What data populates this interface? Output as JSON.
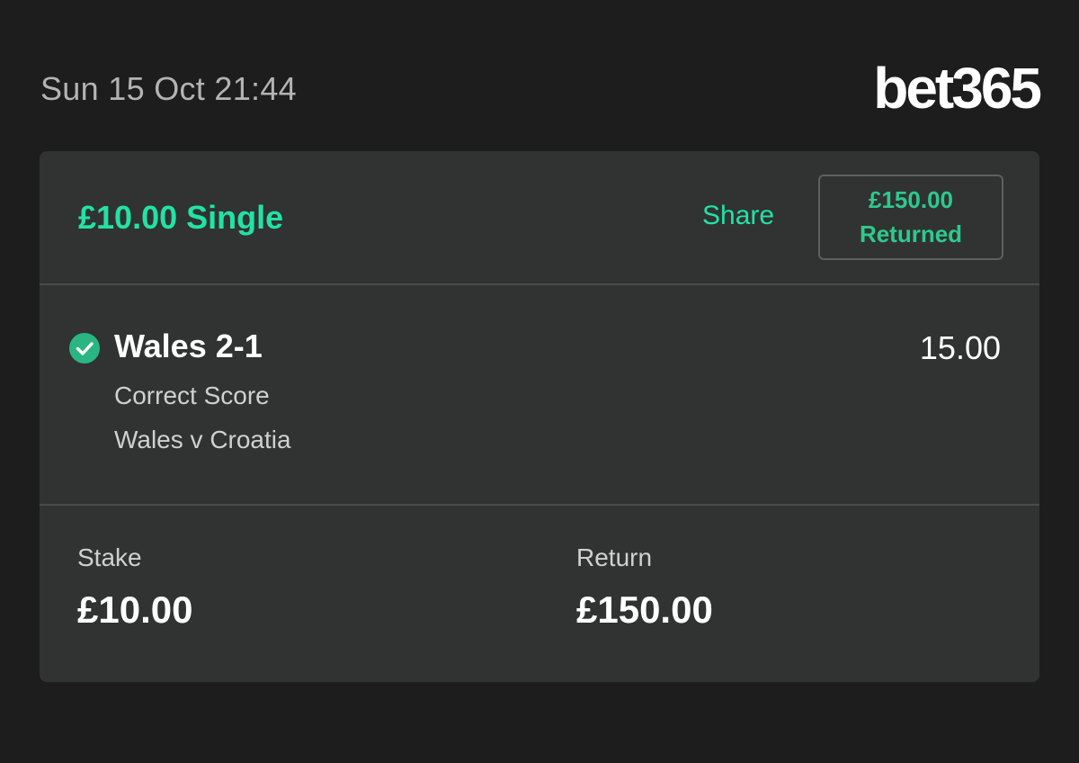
{
  "header": {
    "datetime": "Sun 15 Oct 21:44",
    "brand": "bet365"
  },
  "bet": {
    "title": "£10.00 Single",
    "share_label": "Share",
    "returned_amount": "£150.00",
    "returned_label": "Returned",
    "selection": {
      "status_icon": "check-circle-icon",
      "name": "Wales 2-1",
      "odds": "15.00",
      "market": "Correct Score",
      "event": "Wales v Croatia"
    },
    "summary": {
      "stake_label": "Stake",
      "stake_value": "£10.00",
      "return_label": "Return",
      "return_value": "£150.00"
    }
  },
  "colors": {
    "background": "#1d1d1d",
    "card": "#303332",
    "accent": "#22e2a4",
    "check": "#2ab582"
  }
}
